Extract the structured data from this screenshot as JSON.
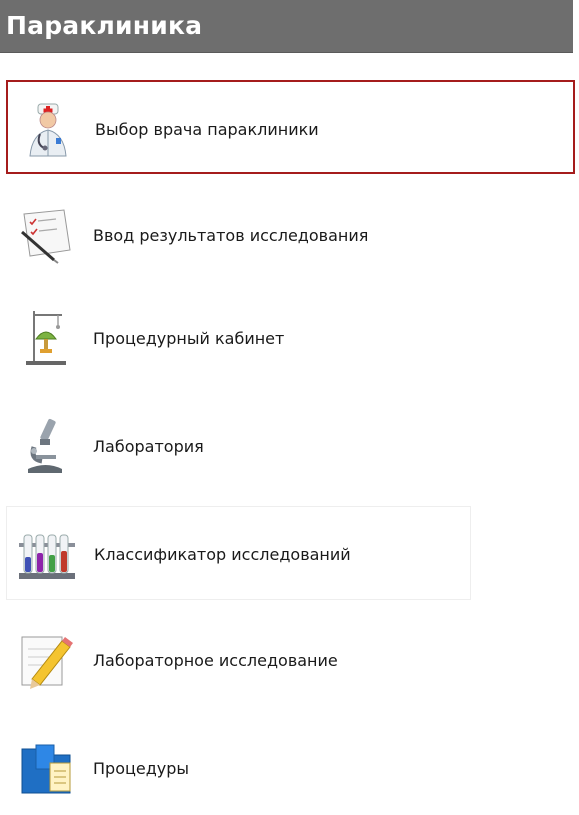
{
  "header": {
    "title": "Параклиника"
  },
  "items": [
    {
      "label": "Выбор врача параклиники",
      "icon": "doctor-icon",
      "selected": true
    },
    {
      "label": "Ввод результатов исследования",
      "icon": "clipboard-pen-icon"
    },
    {
      "label": "Процедурный кабинет",
      "icon": "procedure-stand-icon"
    },
    {
      "label": "Лаборатория",
      "icon": "microscope-icon"
    },
    {
      "label": "Классификатор исследований",
      "icon": "test-tubes-icon"
    },
    {
      "label": "Лабораторное исследование",
      "icon": "pencil-notepad-icon"
    },
    {
      "label": "Процедуры",
      "icon": "documents-folder-icon"
    }
  ],
  "colors": {
    "header_bg": "#6e6e6e",
    "selected_border": "#a51c1c"
  }
}
